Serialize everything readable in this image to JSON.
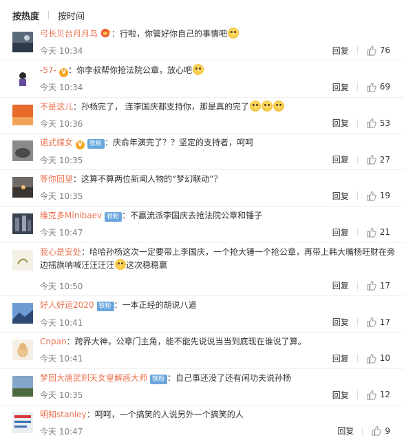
{
  "sort": {
    "hot": "按热度",
    "time": "按时间"
  },
  "comments": [
    {
      "user": "弓长贝台月月鸟",
      "badges": [
        "crown"
      ],
      "text": "行啦，你管好你自己的事情吧",
      "emojis": 1,
      "time": "今天 10:34",
      "reply": "回复",
      "likes": "76"
    },
    {
      "user": "-57-",
      "badges": [
        "vip"
      ],
      "text": "你李叔帮你抢法院公章，放心吧",
      "emojis": 1,
      "time": "今天 10:34",
      "reply": "回复",
      "likes": "69"
    },
    {
      "user": "不是这儿",
      "badges": [],
      "text": "孙杨完了， 连李国庆都支持你，那是真的完了",
      "emojis": 3,
      "time": "今天 10:36",
      "reply": "回复",
      "likes": "53"
    },
    {
      "user": "诺式媒女",
      "badges": [
        "vip",
        "fan"
      ],
      "fan_label": "铁粉",
      "text": "庆俞年演完了？？坚定的支持者，呵呵",
      "emojis": 0,
      "time": "今天 10:35",
      "reply": "回复",
      "likes": "27"
    },
    {
      "user": "等你回望",
      "badges": [],
      "text": "这算不算两位新闻人物的“梦幻联动”？",
      "emojis": 0,
      "time": "今天 10:35",
      "reply": "回复",
      "likes": "19"
    },
    {
      "user": "维克多Minibaev",
      "badges": [
        "fan"
      ],
      "fan_label": "铁粉",
      "text": "不赢流派李国庆去抢法院公章和锤子",
      "emojis": 0,
      "time": "今天 10:47",
      "reply": "回复",
      "likes": "21"
    },
    {
      "user": "我心是安处",
      "badges": [],
      "text": "哈哈孙杨这次一定要带上李国庆，一个抢大锤一个抢公章，再带上韩大嘴杨旺财在旁边摇旗呐喊汪汪汪汪",
      "text_after": "这次稳稳赢",
      "emojis": 1,
      "time": "今天 10:50",
      "reply": "回复",
      "likes": "17"
    },
    {
      "user": "好人好运2020",
      "badges": [
        "fan"
      ],
      "fan_label": "铁粉",
      "text": "一本正经的胡说八道",
      "emojis": 0,
      "time": "今天 10:41",
      "reply": "回复",
      "likes": "17"
    },
    {
      "user": "Cnpan",
      "badges": [],
      "text": "跨界大神，公章门主角，能不能先说说当当到底现在谁说了算。",
      "emojis": 0,
      "time": "今天 10:41",
      "reply": "回复",
      "likes": "10"
    },
    {
      "user": "梦回大唐武则天女皇解惑大师",
      "badges": [
        "fan"
      ],
      "fan_label": "铁粉",
      "text": "自己事还没了还有闲功夫说孙杨",
      "emojis": 0,
      "time": "今天 10:35",
      "reply": "回复",
      "likes": "12"
    },
    {
      "user": "明知stanley",
      "badges": [],
      "text": "呵呵，一个搞笑的人说另外一个搞笑的人",
      "emojis": 0,
      "time": "今天 10:47",
      "reply": "回复",
      "likes": "9"
    }
  ]
}
